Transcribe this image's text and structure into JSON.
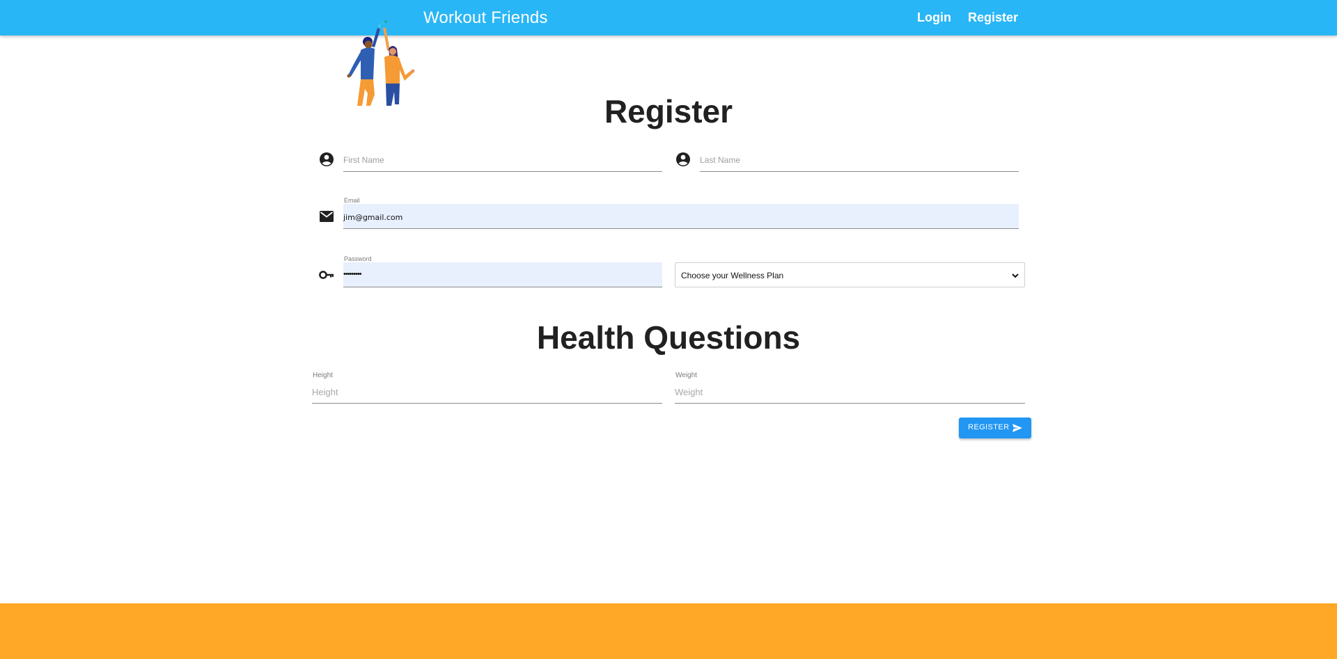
{
  "header": {
    "brand": "Workout Friends",
    "nav": {
      "login_label": "Login",
      "register_label": "Register"
    },
    "background_color": "#29b6f6"
  },
  "logo": {
    "icon": "high-five-friends-illustration"
  },
  "register_form": {
    "title": "Register",
    "first_name": {
      "placeholder": "First Name",
      "icon": "account-circle-icon"
    },
    "last_name": {
      "placeholder": "Last Name",
      "icon": "account-circle-icon"
    },
    "email": {
      "label": "Email",
      "value": "jim@gmail.com",
      "icon": "mail-icon"
    },
    "password": {
      "label": "Password",
      "value": "•••••••••",
      "icon": "key-icon"
    },
    "wellness_plan": {
      "selected": "Choose your Wellness Plan"
    }
  },
  "health": {
    "title": "Health Questions",
    "height": {
      "label": "Height",
      "placeholder": "Height"
    },
    "weight": {
      "label": "Weight",
      "placeholder": "Weight"
    }
  },
  "submit": {
    "label": "REGISTER",
    "icon": "send-icon",
    "color": "#2196f3"
  },
  "footer": {
    "background_color": "#ffa726"
  }
}
